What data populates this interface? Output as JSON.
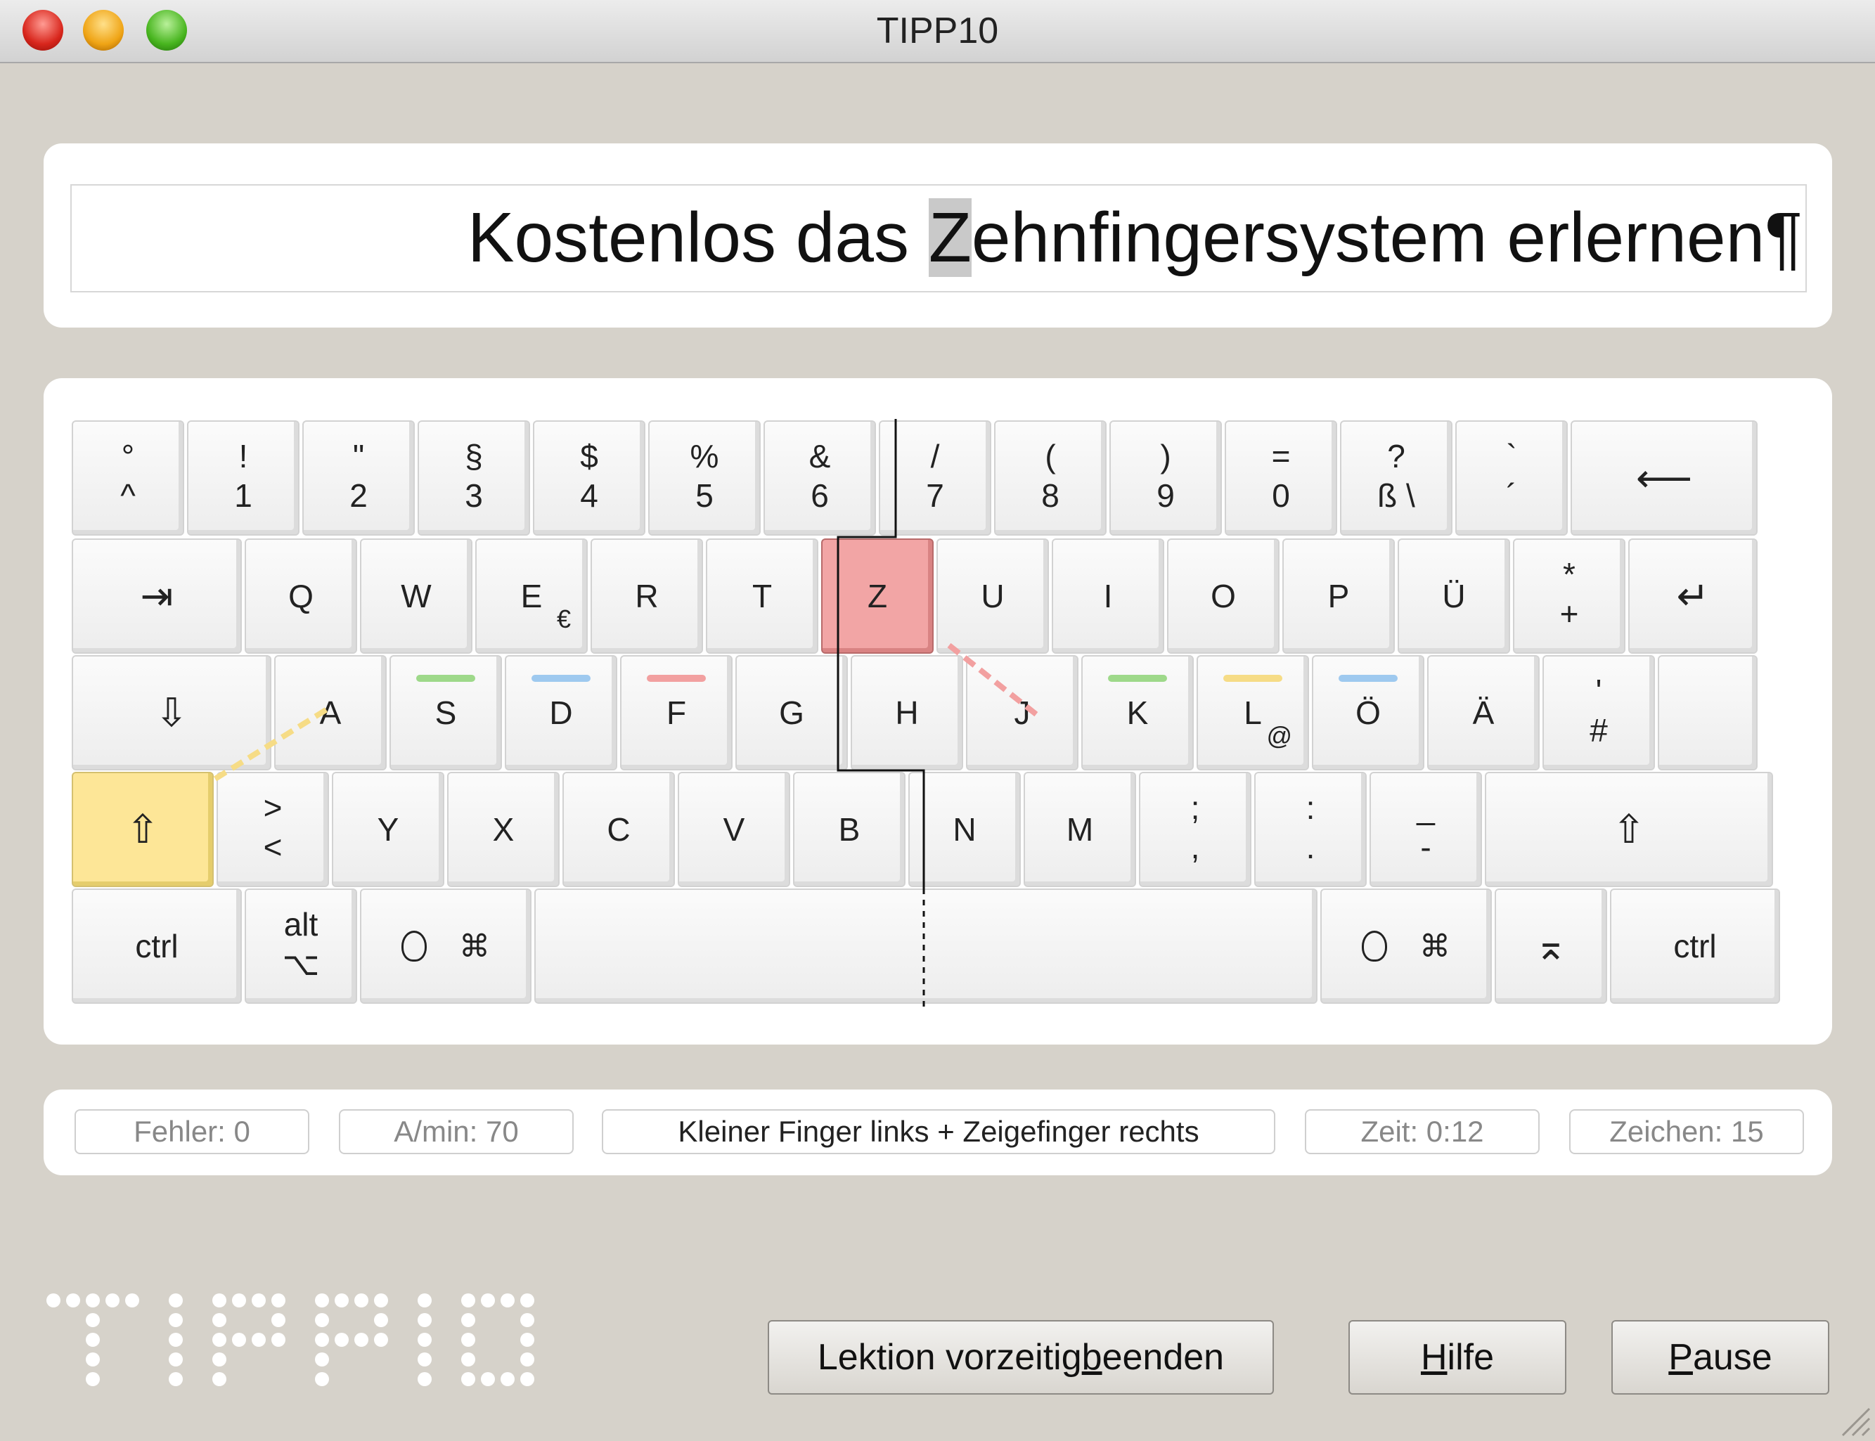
{
  "window": {
    "title": "TIPP10"
  },
  "lesson": {
    "text_before": "Kostenlos das ",
    "current_char": "Z",
    "text_after": "ehnfingersystem erlernen¶"
  },
  "keyboard": {
    "row1": [
      {
        "top": "°",
        "bottom": "^"
      },
      {
        "top": "!",
        "bottom": "1"
      },
      {
        "top": "\"",
        "bottom": "2"
      },
      {
        "top": "§",
        "bottom": "3"
      },
      {
        "top": "$",
        "bottom": "4"
      },
      {
        "top": "%",
        "bottom": "5"
      },
      {
        "top": "&",
        "bottom": "6"
      },
      {
        "top": "/",
        "bottom": "7"
      },
      {
        "top": "(",
        "bottom": "8"
      },
      {
        "top": ")",
        "bottom": "9"
      },
      {
        "top": "=",
        "bottom": "0"
      },
      {
        "top": "?",
        "bottom": "ß \\"
      },
      {
        "top": "`",
        "bottom": "´"
      },
      {
        "main": "⟵"
      }
    ],
    "row2": [
      {
        "main": "⇥"
      },
      {
        "main": "Q"
      },
      {
        "main": "W"
      },
      {
        "main": "E",
        "altgr": "€"
      },
      {
        "main": "R"
      },
      {
        "main": "T"
      },
      {
        "main": "Z"
      },
      {
        "main": "U"
      },
      {
        "main": "I"
      },
      {
        "main": "O"
      },
      {
        "main": "P"
      },
      {
        "main": "Ü"
      },
      {
        "top": "*",
        "bottom": "+"
      },
      {
        "main": "↵"
      }
    ],
    "row3": [
      {
        "main": "⇩"
      },
      {
        "main": "A"
      },
      {
        "main": "S"
      },
      {
        "main": "D"
      },
      {
        "main": "F"
      },
      {
        "main": "G"
      },
      {
        "main": "H"
      },
      {
        "main": "J"
      },
      {
        "main": "K"
      },
      {
        "main": "L",
        "altgr": "@"
      },
      {
        "main": "Ö"
      },
      {
        "main": "Ä"
      },
      {
        "top": "'",
        "bottom": "#"
      },
      {
        "main": ""
      }
    ],
    "row4": [
      {
        "main": "⇧"
      },
      {
        "top": ">",
        "bottom": "<"
      },
      {
        "main": "Y"
      },
      {
        "main": "X"
      },
      {
        "main": "C"
      },
      {
        "main": "V"
      },
      {
        "main": "B"
      },
      {
        "main": "N"
      },
      {
        "main": "M"
      },
      {
        "top": ";",
        "bottom": ","
      },
      {
        "top": ":",
        "bottom": "."
      },
      {
        "top": "_",
        "bottom": "-"
      },
      {
        "main": "⇧"
      }
    ],
    "row5": [
      {
        "main": "ctrl"
      },
      {
        "top": "alt",
        "bottom": "⌥"
      },
      {
        "main": "  ⌘"
      },
      {
        "main": ""
      },
      {
        "main": "  ⌘"
      },
      {
        "main": "⌅"
      },
      {
        "main": "ctrl"
      }
    ],
    "highlight_colors": {
      "target": "#f2a5a5",
      "modifier": "#fde697"
    },
    "finger_colors": {
      "green": "#9ed98a",
      "blue": "#9ec9ef",
      "red": "#f2a0a0",
      "yellow": "#f6dc86"
    }
  },
  "status": {
    "errors": "Fehler: 0",
    "speed": "A/min: 70",
    "hint": "Kleiner Finger links + Zeigefinger rechts",
    "time": "Zeit: 0:12",
    "chars": "Zeichen: 15"
  },
  "logo": {
    "text": "TIPP10"
  },
  "buttons": {
    "end_lesson": {
      "pre": "Lektion vorzeitig ",
      "ul": "b",
      "post": "eenden"
    },
    "help": {
      "pre": "",
      "ul": "H",
      "post": "ilfe"
    },
    "pause": {
      "pre": "",
      "ul": "P",
      "post": "ause"
    }
  }
}
